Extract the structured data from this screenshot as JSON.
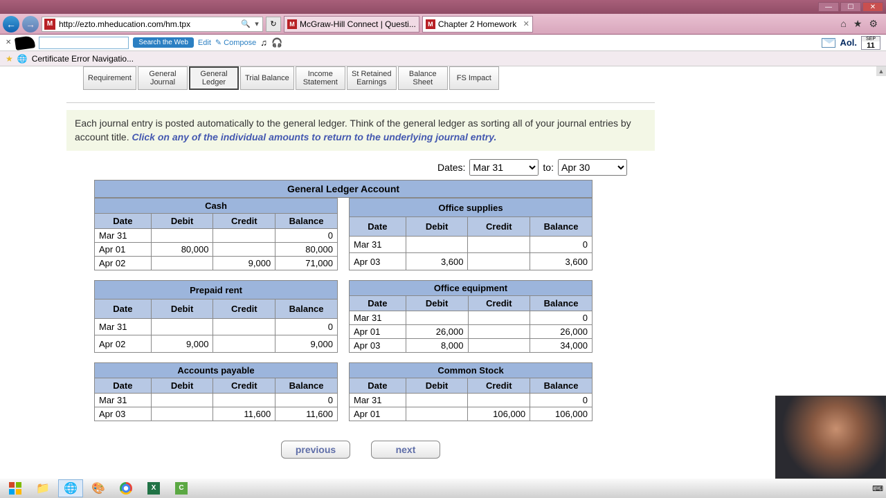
{
  "window": {
    "min": "—",
    "max": "☐",
    "close": "✕"
  },
  "browser": {
    "back_glyph": "←",
    "forward_glyph": "→",
    "url": "http://ezto.mheducation.com/hm.tpx",
    "search_glyph": "🔍",
    "dropdown_glyph": "▾",
    "refresh_glyph": "↻",
    "tabs": [
      {
        "title": "McGraw-Hill Connect | Questi..."
      },
      {
        "title": "Chapter 2 Homework"
      }
    ],
    "home_glyph": "⌂",
    "star_glyph": "★",
    "gear_glyph": "⚙"
  },
  "aol": {
    "search_btn": "Search the Web",
    "edit": "Edit",
    "compose": "Compose",
    "music_glyph": "♫",
    "headphone_glyph": "🎧",
    "brand": "Aol.",
    "cal_month": "SEP",
    "cal_day": "11"
  },
  "bookmark": {
    "cert_error": "Certificate Error Navigatio..."
  },
  "tabs": [
    {
      "label1": "Requirement",
      "label2": ""
    },
    {
      "label1": "General",
      "label2": "Journal"
    },
    {
      "label1": "General",
      "label2": "Ledger"
    },
    {
      "label1": "Trial Balance",
      "label2": ""
    },
    {
      "label1": "Income",
      "label2": "Statement"
    },
    {
      "label1": "St Retained",
      "label2": "Earnings"
    },
    {
      "label1": "Balance",
      "label2": "Sheet"
    },
    {
      "label1": "FS Impact",
      "label2": ""
    }
  ],
  "active_tab_index": 2,
  "instructions": {
    "text": "Each journal entry is posted automatically to the general ledger.   Think of the general ledger as sorting all of your journal entries by account title.  ",
    "link": "Click on any of the individual amounts to return to the underlying journal entry."
  },
  "dates": {
    "label": "Dates:",
    "from": "Mar 31",
    "to_label": "to:",
    "to": "Apr 30"
  },
  "ledger": {
    "header": "General Ledger Account",
    "columns": {
      "date": "Date",
      "debit": "Debit",
      "credit": "Credit",
      "balance": "Balance"
    },
    "accounts": [
      {
        "name": "Cash",
        "rows": [
          {
            "date": "Mar 31",
            "debit": "",
            "credit": "",
            "balance": "0"
          },
          {
            "date": "Apr 01",
            "debit": "80,000",
            "credit": "",
            "balance": "80,000"
          },
          {
            "date": "Apr 02",
            "debit": "",
            "credit": "9,000",
            "balance": "71,000"
          }
        ]
      },
      {
        "name": "Office supplies",
        "rows": [
          {
            "date": "Mar 31",
            "debit": "",
            "credit": "",
            "balance": "0"
          },
          {
            "date": "Apr 03",
            "debit": "3,600",
            "credit": "",
            "balance": "3,600"
          }
        ]
      },
      {
        "name": "Prepaid rent",
        "rows": [
          {
            "date": "Mar 31",
            "debit": "",
            "credit": "",
            "balance": "0"
          },
          {
            "date": "Apr 02",
            "debit": "9,000",
            "credit": "",
            "balance": "9,000"
          }
        ]
      },
      {
        "name": "Office equipment",
        "rows": [
          {
            "date": "Mar 31",
            "debit": "",
            "credit": "",
            "balance": "0"
          },
          {
            "date": "Apr 01",
            "debit": "26,000",
            "credit": "",
            "balance": "26,000"
          },
          {
            "date": "Apr 03",
            "debit": "8,000",
            "credit": "",
            "balance": "34,000"
          }
        ]
      },
      {
        "name": "Accounts payable",
        "rows": [
          {
            "date": "Mar 31",
            "debit": "",
            "credit": "",
            "balance": "0"
          },
          {
            "date": "Apr 03",
            "debit": "",
            "credit": "11,600",
            "balance": "11,600"
          }
        ]
      },
      {
        "name": "Common Stock",
        "rows": [
          {
            "date": "Mar 31",
            "debit": "",
            "credit": "",
            "balance": "0"
          },
          {
            "date": "Apr 01",
            "debit": "",
            "credit": "106,000",
            "balance": "106,000"
          }
        ]
      }
    ]
  },
  "nav": {
    "prev": "previous",
    "next": "next"
  },
  "taskbar": {
    "keyboard_glyph": "⌨"
  }
}
